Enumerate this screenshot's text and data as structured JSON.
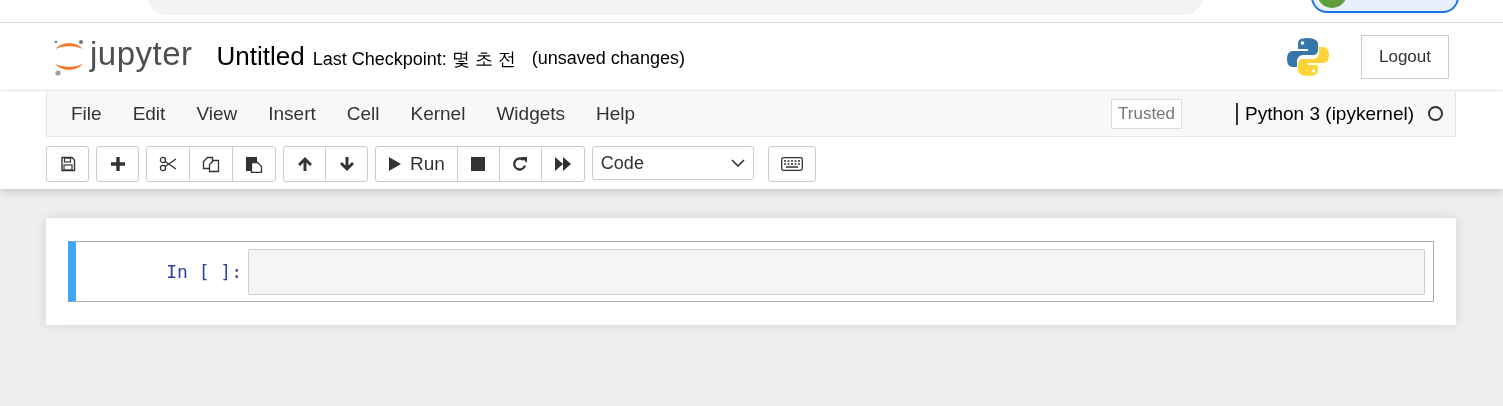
{
  "header": {
    "logo": "jupyter",
    "title": "Untitled",
    "checkpoint": "Last Checkpoint: 몇 초 전",
    "autosave_status": "(unsaved changes)",
    "logout": "Logout"
  },
  "menubar": {
    "items": [
      "File",
      "Edit",
      "View",
      "Insert",
      "Cell",
      "Kernel",
      "Widgets",
      "Help"
    ],
    "trusted": "Trusted",
    "kernel_name": "Python 3 (ipykernel)",
    "kernel_busy": false
  },
  "toolbar": {
    "groups": [
      [
        {
          "kind": "save"
        }
      ],
      [
        {
          "kind": "plus"
        }
      ],
      [
        {
          "kind": "cut"
        },
        {
          "kind": "copy"
        },
        {
          "kind": "paste"
        }
      ],
      [
        {
          "kind": "up"
        },
        {
          "kind": "down"
        }
      ],
      [
        {
          "kind": "run",
          "label": "Run"
        },
        {
          "kind": "stop"
        },
        {
          "kind": "restart"
        },
        {
          "kind": "fastforward"
        }
      ],
      [
        {
          "kind": "celltype",
          "value": "Code"
        }
      ],
      [
        {
          "kind": "keyboard"
        }
      ]
    ]
  },
  "cells": [
    {
      "prompt": "In [ ]:",
      "selected": true
    }
  ]
}
